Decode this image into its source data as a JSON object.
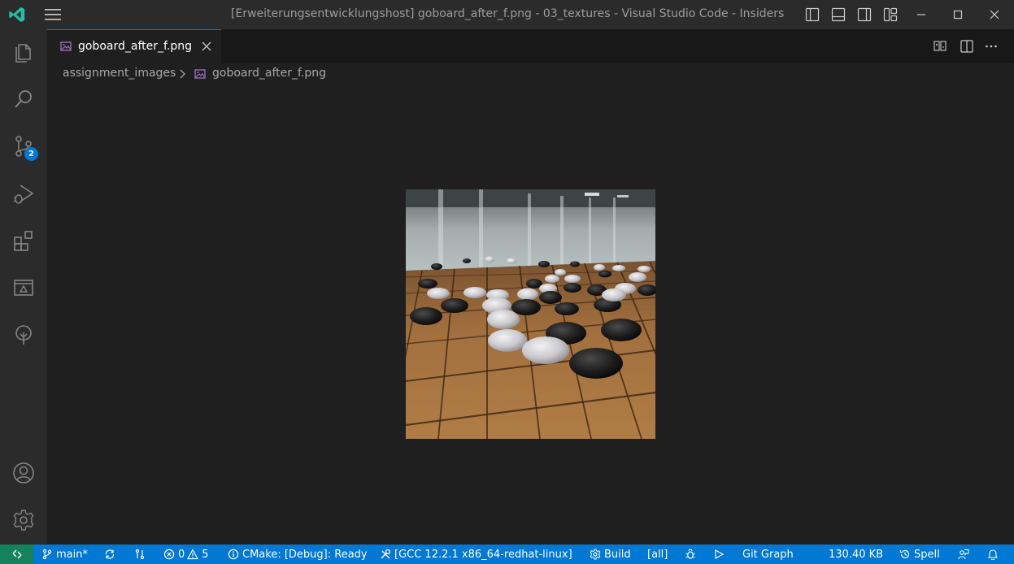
{
  "window": {
    "title": "[Erweiterungsentwicklungshost] goboard_after_f.png - 03_textures - Visual Studio Code - Insiders"
  },
  "activity_bar": {
    "source_control_badge": "2"
  },
  "editor": {
    "tab_label": "goboard_after_f.png",
    "breadcrumb_folder": "assignment_images",
    "breadcrumb_file": "goboard_after_f.png"
  },
  "statusbar": {
    "branch": "main*",
    "errors": "0",
    "warnings": "5",
    "cmake_status": "CMake: [Debug]: Ready",
    "kit": "[GCC 12.2.1 x86_64-redhat-linux]",
    "build": "Build",
    "target": "[all]",
    "git_graph": "Git Graph",
    "file_size": "130.40 KB",
    "spell": "Spell"
  },
  "colors": {
    "accent": "#0078d4",
    "remote": "#16825d",
    "background": "#1f1f1f",
    "chrome": "#2b2b2b"
  }
}
